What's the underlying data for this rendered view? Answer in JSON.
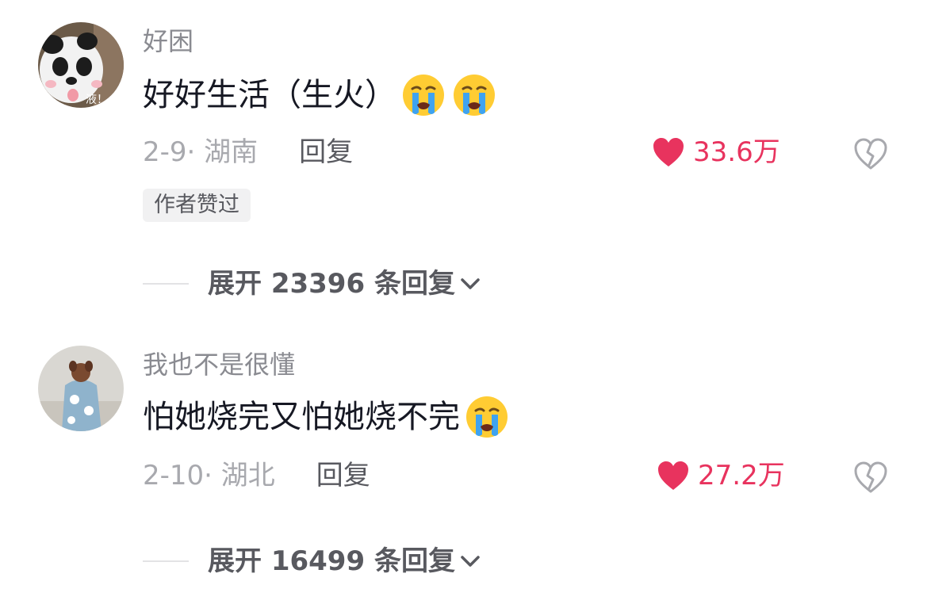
{
  "comments": [
    {
      "username": "好困",
      "text": "好好生活（生火）",
      "emojis": [
        "crying-emoji",
        "crying-emoji"
      ],
      "date_location": "2-9· 湖南",
      "reply_label": "回复",
      "like_count": "33.6万",
      "badge": "作者赞过",
      "expand_label": "展开 23396 条回复",
      "avatar_text": "液！"
    },
    {
      "username": "我也不是很懂",
      "text": "怕她烧完又怕她烧不完",
      "emojis": [
        "crying-emoji"
      ],
      "date_location": "2-10· 湖北",
      "reply_label": "回复",
      "like_count": "27.2万",
      "expand_label": "展开 16499 条回复"
    }
  ],
  "colors": {
    "like_red": "#e8335e",
    "muted_text": "#a8a9ae",
    "username_grey": "#8a8b91"
  }
}
